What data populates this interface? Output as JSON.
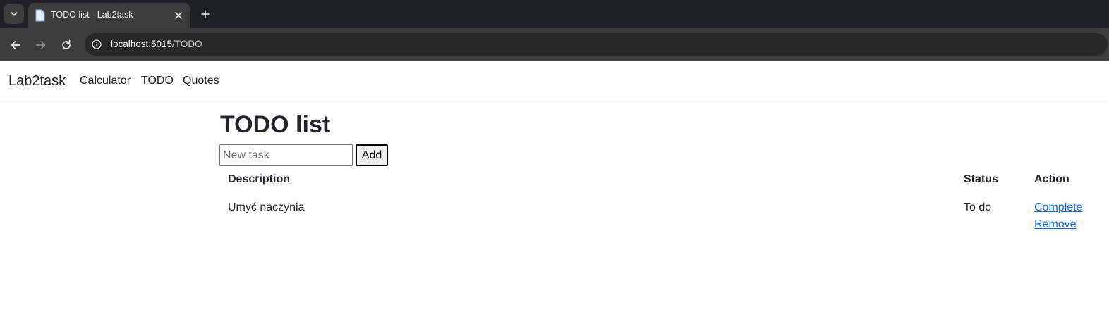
{
  "browser": {
    "tab_title": "TODO list - Lab2task",
    "url_host": "localhost:5015",
    "url_path": "/TODO"
  },
  "navbar": {
    "brand": "Lab2task",
    "links": [
      "Calculator",
      "TODO",
      "Quotes"
    ]
  },
  "main": {
    "title": "TODO list",
    "new_task": {
      "placeholder": "New task",
      "value": ""
    },
    "add_label": "Add",
    "table": {
      "headers": [
        "Description",
        "Status",
        "Action"
      ],
      "rows": [
        {
          "description": "Umyć naczynia",
          "status": "To do",
          "actions": [
            "Complete",
            "Remove"
          ]
        }
      ]
    }
  },
  "icons": {
    "tab_menu": "chevron-down-icon",
    "favicon": "page-icon",
    "close": "close-icon",
    "new_tab": "plus-icon",
    "back": "arrow-left-icon",
    "forward": "arrow-right-icon",
    "reload": "reload-icon",
    "site_info": "info-icon"
  },
  "colors": {
    "link": "#0d6efd",
    "chrome_dark": "#202124",
    "toolbar": "#3c3c3c"
  }
}
